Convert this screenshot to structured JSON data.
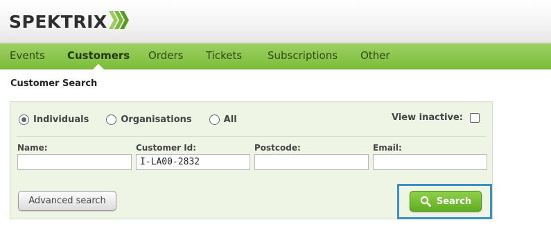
{
  "brand": {
    "logo_text": "SPEKTRIX",
    "logo_icon": "chevrons-icon"
  },
  "nav": {
    "items": [
      {
        "label": "Events"
      },
      {
        "label": "Customers",
        "active": true
      },
      {
        "label": "Orders"
      },
      {
        "label": "Tickets"
      },
      {
        "label": "Subscriptions"
      },
      {
        "label": "Other"
      }
    ]
  },
  "page": {
    "title": "Customer Search"
  },
  "search": {
    "types": [
      {
        "label": "Individuals",
        "selected": true
      },
      {
        "label": "Organisations",
        "selected": false
      },
      {
        "label": "All",
        "selected": false
      }
    ],
    "view_inactive_label": "View inactive:",
    "view_inactive_checked": false,
    "fields": [
      {
        "label": "Name:",
        "value": ""
      },
      {
        "label": "Customer Id:",
        "value": "I-LA00-2832"
      },
      {
        "label": "Postcode:",
        "value": ""
      },
      {
        "label": "Email:",
        "value": ""
      }
    ],
    "advanced_label": "Advanced search",
    "search_label": "Search",
    "search_icon": "search-icon"
  },
  "colors": {
    "nav_green": "#7dbd38",
    "panel_bg": "#eef5e5",
    "button_green": "#5fae1f",
    "highlight_blue": "#3a8fc4"
  }
}
